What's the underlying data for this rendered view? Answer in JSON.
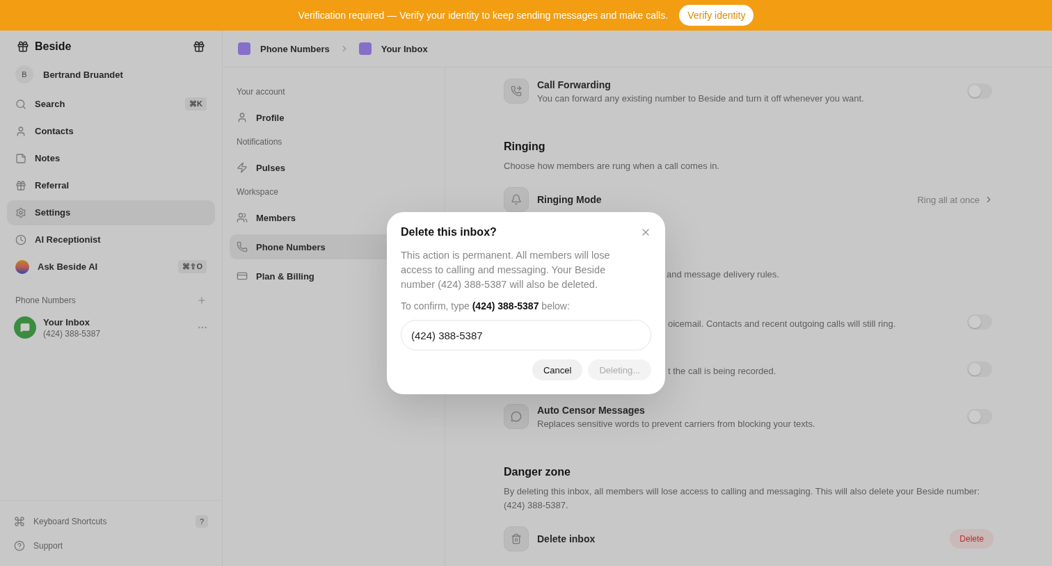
{
  "banner": {
    "text": "Verification required — Verify your identity to keep sending messages and make calls.",
    "button": "Verify identity"
  },
  "sidebar": {
    "brand": "Beside",
    "user": {
      "initial": "B",
      "name": "Bertrand Bruandet"
    },
    "nav": [
      {
        "label": "Search",
        "shortcut": "⌘K",
        "selected": false
      },
      {
        "label": "Contacts",
        "selected": false
      },
      {
        "label": "Notes",
        "selected": false
      },
      {
        "label": "Referral",
        "selected": false
      },
      {
        "label": "Settings",
        "selected": true
      },
      {
        "label": "AI Receptionist",
        "selected": false
      },
      {
        "label": "Ask Beside AI",
        "shortcut": "⌘⇧O",
        "selected": false
      }
    ],
    "section": "Phone Numbers",
    "inboxes": [
      {
        "name": "Your Inbox",
        "number": "(424) 388-5387"
      }
    ],
    "footer": [
      {
        "label": "Keyboard Shortcuts",
        "key": "?"
      },
      {
        "label": "Support"
      }
    ]
  },
  "breadcrumb": [
    "Phone Numbers",
    "Your Inbox"
  ],
  "settings_nav": [
    {
      "title": "Your account",
      "items": [
        {
          "label": "Profile",
          "selected": false
        }
      ]
    },
    {
      "title": "Notifications",
      "items": [
        {
          "label": "Pulses",
          "selected": false
        }
      ]
    },
    {
      "title": "Workspace",
      "items": [
        {
          "label": "Members",
          "selected": false
        },
        {
          "label": "Phone Numbers",
          "selected": true
        },
        {
          "label": "Plan & Billing",
          "selected": false
        }
      ]
    }
  ],
  "content": [
    {
      "rows": [
        {
          "kind": "toggle",
          "title": "Call Forwarding",
          "description": "You can forward any existing number to Beside and turn it off whenever you want.",
          "on": false
        }
      ]
    },
    {
      "heading": "Ringing",
      "description": "Choose how members are rung when a call comes in.",
      "rows": [
        {
          "kind": "select",
          "title": "Ringing Mode",
          "value": "Ring all at once"
        }
      ]
    },
    {
      "description": "and message delivery rules.",
      "rows": [
        {
          "kind": "toggle",
          "description": "oicemail. Contacts and recent outgoing calls will still ring.",
          "on": false
        },
        {
          "kind": "toggle",
          "description": "t the call is being recorded.",
          "on": false
        },
        {
          "kind": "toggle",
          "title": "Auto Censor Messages",
          "description": "Replaces sensitive words to prevent carriers from blocking your texts.",
          "on": false
        }
      ]
    },
    {
      "heading": "Danger zone",
      "description": "By deleting this inbox, all members will lose access to calling and messaging. This will also delete your Beside number: (424) 388-5387.",
      "rows": [
        {
          "kind": "action",
          "title": "Delete inbox",
          "button": "Delete"
        }
      ]
    }
  ],
  "modal": {
    "title": "Delete this inbox?",
    "body": "This action is permanent. All members will lose access to calling and messaging. Your Beside number (424) 388-5387 will also be deleted.",
    "prompt": "To confirm, type **(424) 388-5387** below:",
    "input": "(424) 388-5387",
    "buttons": [
      {
        "label": "Cancel",
        "kind": "secondary",
        "disabled": false
      },
      {
        "label": "Deleting...",
        "kind": "primary",
        "disabled": true
      }
    ]
  }
}
